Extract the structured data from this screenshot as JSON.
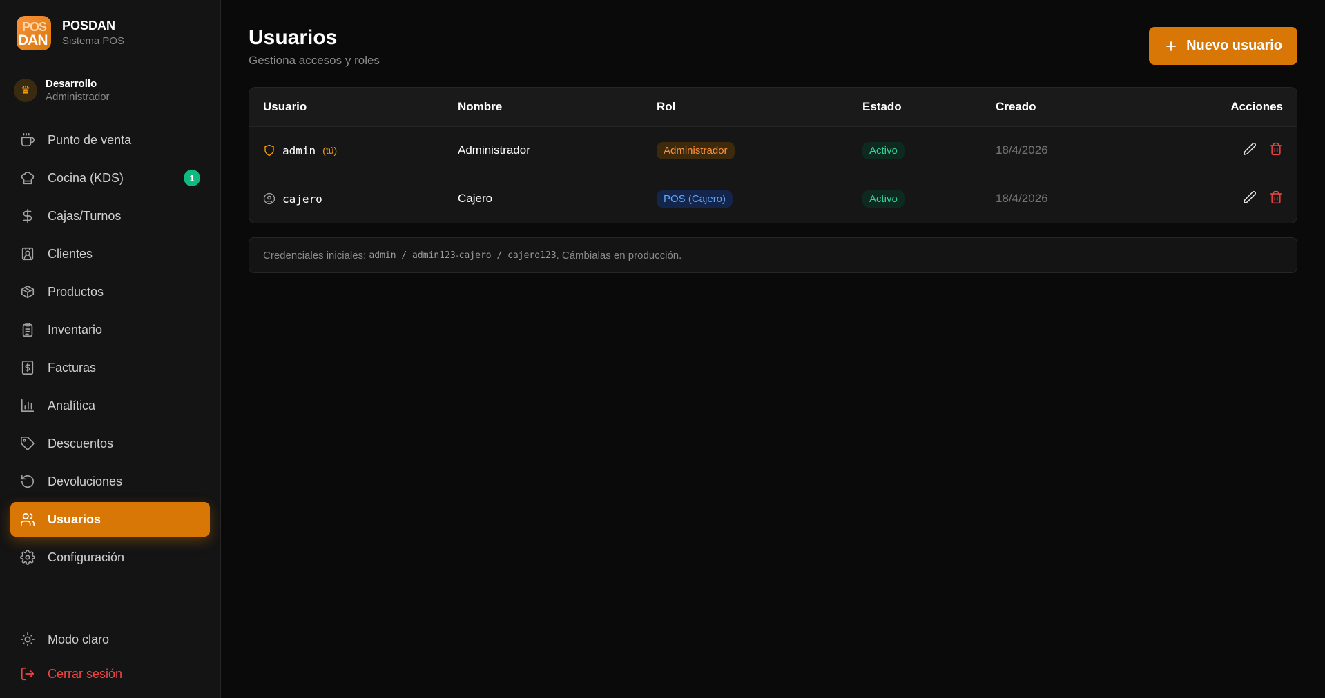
{
  "brand": {
    "logo_top": "POS",
    "logo_bottom": "DAN",
    "name": "POSDAN",
    "subtitle": "Sistema POS"
  },
  "current_user": {
    "name": "Desarrollo",
    "role": "Administrador"
  },
  "nav": [
    {
      "label": "Punto de venta",
      "icon": "coffee-icon"
    },
    {
      "label": "Cocina (KDS)",
      "icon": "chef-hat-icon",
      "badge": "1"
    },
    {
      "label": "Cajas/Turnos",
      "icon": "dollar-icon"
    },
    {
      "label": "Clientes",
      "icon": "contact-icon"
    },
    {
      "label": "Productos",
      "icon": "package-icon"
    },
    {
      "label": "Inventario",
      "icon": "clipboard-icon"
    },
    {
      "label": "Facturas",
      "icon": "receipt-icon"
    },
    {
      "label": "Analítica",
      "icon": "bar-chart-icon"
    },
    {
      "label": "Descuentos",
      "icon": "tag-icon"
    },
    {
      "label": "Devoluciones",
      "icon": "undo-icon"
    },
    {
      "label": "Usuarios",
      "icon": "users-icon",
      "active": true
    },
    {
      "label": "Configuración",
      "icon": "gear-icon"
    }
  ],
  "bottom": {
    "theme_label": "Modo claro",
    "logout_label": "Cerrar sesión"
  },
  "page": {
    "title": "Usuarios",
    "subtitle": "Gestiona accesos y roles",
    "new_button": "Nuevo usuario"
  },
  "table": {
    "headers": {
      "user": "Usuario",
      "name": "Nombre",
      "role": "Rol",
      "status": "Estado",
      "created": "Creado",
      "actions": "Acciones"
    },
    "rows": [
      {
        "username": "admin",
        "you": "(tú)",
        "name": "Administrador",
        "role": "Administrador",
        "status": "Activo",
        "created": "18/4/2026"
      },
      {
        "username": "cajero",
        "you": "",
        "name": "Cajero",
        "role": "POS (Cajero)",
        "status": "Activo",
        "created": "18/4/2026"
      }
    ]
  },
  "note": {
    "prefix": "Credenciales iniciales: ",
    "cred1": "admin / admin123",
    "sep": " · ",
    "cred2": "cajero / cajero123",
    "suffix": ". Cámbialas en producción."
  },
  "colors": {
    "accent": "#d97706",
    "success": "#10b981",
    "danger": "#ef4444",
    "info": "#60a5fa"
  }
}
